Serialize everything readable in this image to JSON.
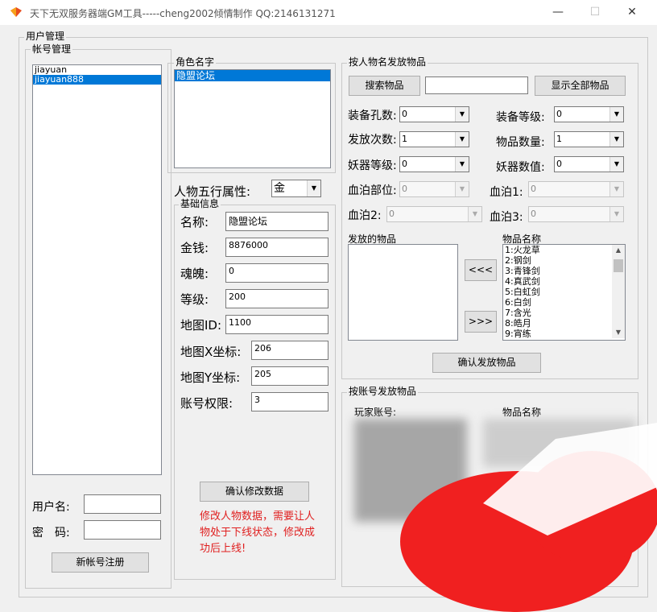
{
  "window": {
    "title": "天下无双服务器端GM工具-----cheng2002倾情制作  QQ:2146131271",
    "minimize": "—",
    "maximize": "☐",
    "close": "✕"
  },
  "user_mgmt": {
    "label": "用户管理"
  },
  "account_mgmt": {
    "label": "帐号管理",
    "accounts": [
      "jiayuan",
      "jiayuan888"
    ],
    "username_label": "用户名:",
    "password_label": "密　码:",
    "username_value": "",
    "password_value": "",
    "register_button": "新帐号注册"
  },
  "role": {
    "label": "角色名字",
    "names": [
      "隐盟论坛"
    ]
  },
  "five_elements": {
    "label": "人物五行属性:",
    "value": "金"
  },
  "basic_info": {
    "label": "基础信息",
    "name_label": "名称:",
    "name_value": "隐盟论坛",
    "money_label": "金钱:",
    "money_value": "8876000",
    "soul_label": "魂魄:",
    "soul_value": "0",
    "level_label": "等级:",
    "level_value": "200",
    "map_label": "地图ID:",
    "map_value": "1100",
    "mapx_label": "地图X坐标:",
    "mapx_value": "206",
    "mapy_label": "地图Y坐标:",
    "mapy_value": "205",
    "perm_label": "账号权限:",
    "perm_value": "3",
    "confirm_button": "确认修改数据",
    "warning": "修改人物数据，需要让人物处于下线状态，修改成功后上线!"
  },
  "by_name": {
    "label": "按人物名发放物品",
    "search_button": "搜索物品",
    "search_value": "",
    "show_all_button": "显示全部物品",
    "holes_label": "装备孔数:",
    "holes_value": "0",
    "equip_level_label": "装备等级:",
    "equip_level_value": "0",
    "times_label": "发放次数:",
    "times_value": "1",
    "quantity_label": "物品数量:",
    "quantity_value": "1",
    "demon_level_label": "妖器等级:",
    "demon_level_value": "0",
    "demon_value_label": "妖器数值:",
    "demon_value_value": "0",
    "blood_part_label": "血泊部位:",
    "blood_part_value": "0",
    "blood1_label": "血泊1:",
    "blood1_value": "0",
    "blood2_label": "血泊2:",
    "blood2_value": "0",
    "blood3_label": "血泊3:",
    "blood3_value": "0",
    "issued_label": "发放的物品",
    "item_name_label": "物品名称",
    "items": [
      "1:火龙草",
      "2:钢剑",
      "3:青锋剑",
      "4:真武剑",
      "5:白虹剑",
      "6:白剑",
      "7:含光",
      "8:皓月",
      "9:宵练"
    ],
    "move_left": "<<<",
    "move_right": ">>>",
    "confirm_button": "确认发放物品"
  },
  "by_account": {
    "label": "按账号发放物品",
    "player_account_label": "玩家账号:",
    "item_name_label": "物品名称",
    "partial_text": "发放"
  },
  "colors": {
    "selection": "#0078d7",
    "warning": "#e02020",
    "redact_red": "#f02020"
  }
}
